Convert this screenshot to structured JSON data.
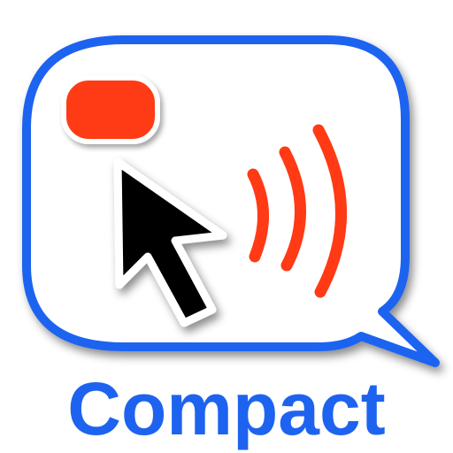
{
  "icon": {
    "label": "Compact",
    "symbols": [
      "speech-bubble-icon",
      "record-dot-icon",
      "cursor-arrow-icon",
      "sound-waves-icon"
    ],
    "colors": {
      "bubble_outline": "#1e63f0",
      "record": "#ff3a14",
      "waves": "#ff3a14",
      "cursor": "#000000",
      "label": "#1e63f0",
      "background": "#ffffff"
    }
  }
}
